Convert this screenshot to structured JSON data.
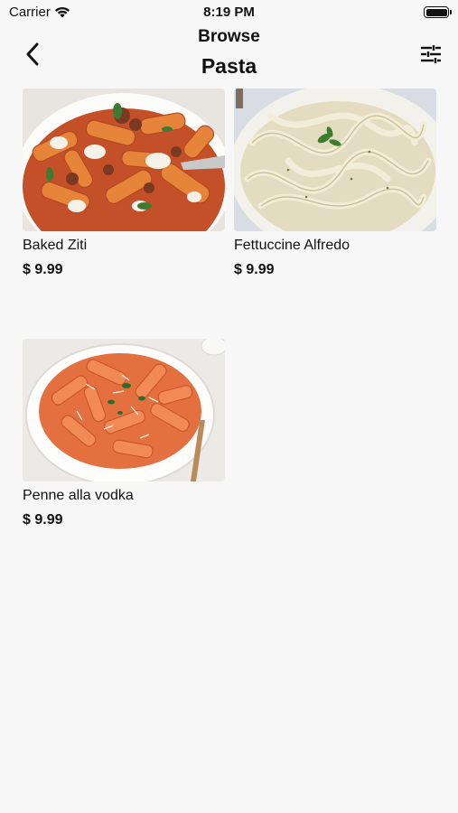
{
  "status_bar": {
    "carrier": "Carrier",
    "time": "8:19 PM"
  },
  "nav": {
    "subtitle": "Browse",
    "title": "Pasta"
  },
  "products": [
    {
      "name": "Baked Ziti",
      "price": "$ 9.99"
    },
    {
      "name": "Fettuccine Alfredo",
      "price": "$ 9.99"
    },
    {
      "name": "Penne alla vodka",
      "price": "$ 9.99"
    }
  ]
}
